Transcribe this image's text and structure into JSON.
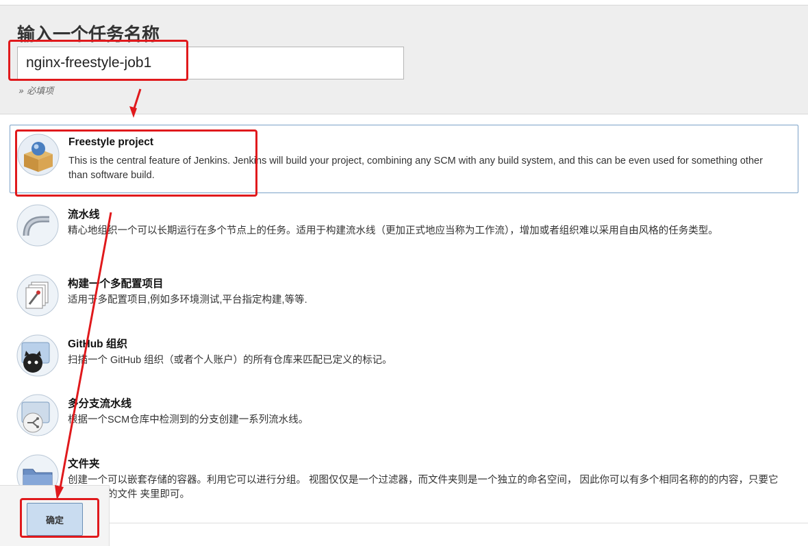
{
  "header": {
    "title": "输入一个任务名称",
    "name_value": "nginx-freestyle-job1",
    "required_note": "» 必填项"
  },
  "items": [
    {
      "title": "Freestyle project",
      "description": "This is the central feature of Jenkins. Jenkins will build your project, combining any SCM with any build system, and this can be even used for something other than software build.",
      "icon": "freestyle-box-icon",
      "selected": true
    },
    {
      "title": "流水线",
      "description": "精心地组织一个可以长期运行在多个节点上的任务。适用于构建流水线（更加正式地应当称为工作流），增加或者组织难以采用自由风格的任务类型。",
      "icon": "pipeline-icon"
    },
    {
      "title": "构建一个多配置项目",
      "description": "适用于多配置项目,例如多环境测试,平台指定构建,等等.",
      "icon": "multi-config-icon"
    },
    {
      "title": "GitHub 组织",
      "description": "扫描一个 GitHub 组织（或者个人账户）的所有仓库来匹配已定义的标记。",
      "icon": "github-org-icon"
    },
    {
      "title": "多分支流水线",
      "description": "根据一个SCM仓库中检测到的分支创建一系列流水线。",
      "icon": "multibranch-icon"
    },
    {
      "title": "文件夹",
      "description": "创建一个可以嵌套存储的容器。利用它可以进行分组。 视图仅仅是一个过滤器，而文件夹则是一个独立的命名空间， 因此你可以有多个相同名称的的内容，只要它们在不同的文件 夹里即可。",
      "icon": "folder-icon"
    }
  ],
  "footer": {
    "ok_label": "确定"
  },
  "colors": {
    "highlight": "#e0191c",
    "selected_border": "#7aa1c7",
    "ok_button": "#c9dcf0"
  }
}
